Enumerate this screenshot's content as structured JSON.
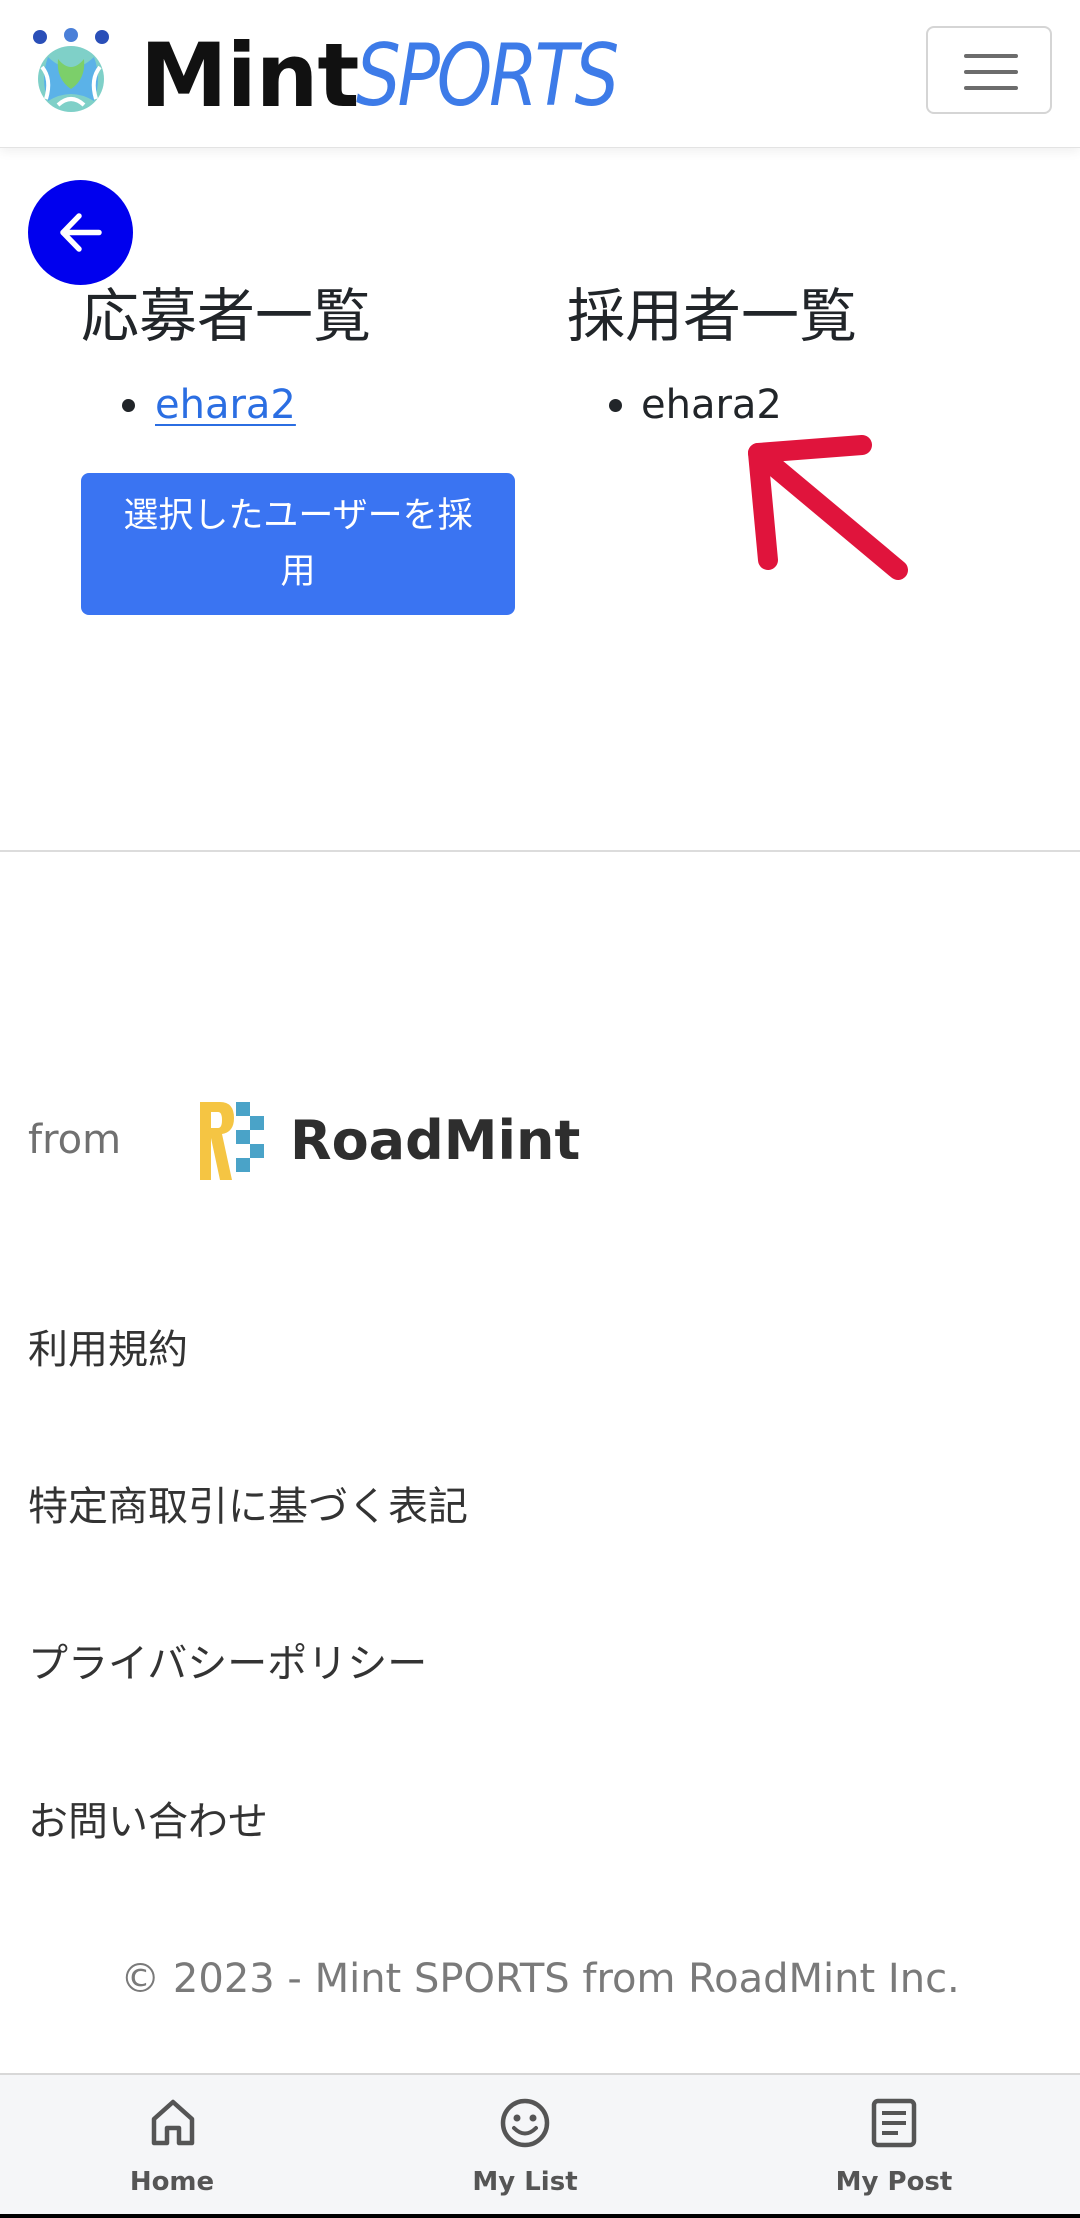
{
  "header": {
    "brand_mint": "Mint",
    "brand_sports": "SPORTS",
    "menu_icon": "hamburger-icon"
  },
  "back_button": {
    "icon": "arrow-left-icon",
    "color": "#0000ee"
  },
  "applicants": {
    "title": "応募者一覧",
    "items": [
      "ehara2"
    ]
  },
  "hired": {
    "title": "採用者一覧",
    "items": [
      "ehara2"
    ]
  },
  "hire_button": {
    "label": "選択したユーザーを採用",
    "color": "#3a74f2"
  },
  "annotation": {
    "icon": "red-arrow-icon",
    "color": "#e0143c"
  },
  "footer": {
    "from_label": "from",
    "partner_name": "RoadMint",
    "links": [
      "利用規約",
      "特定商取引に基づく表記",
      "プライバシーポリシー",
      "お問い合わせ"
    ],
    "copyright": "© 2023 - Mint SPORTS from RoadMint Inc."
  },
  "bottom_nav": {
    "items": [
      {
        "label": "Home",
        "icon": "home-icon"
      },
      {
        "label": "My List",
        "icon": "smiley-icon"
      },
      {
        "label": "My Post",
        "icon": "document-icon"
      }
    ]
  }
}
